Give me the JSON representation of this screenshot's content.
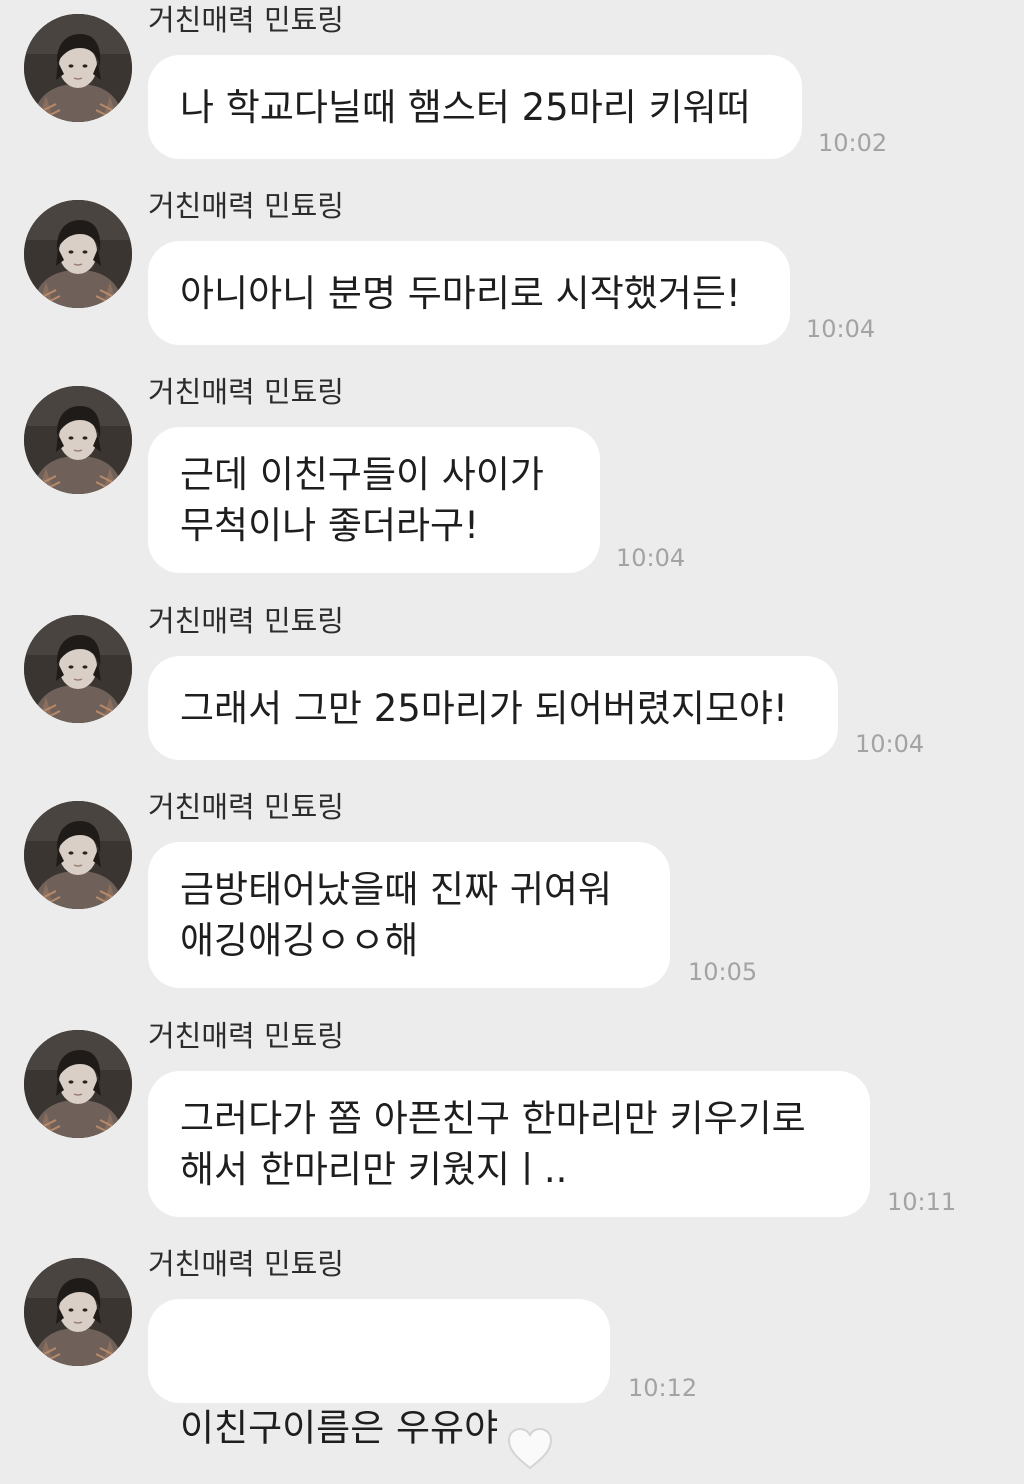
{
  "messages": [
    {
      "sender": "거친매력 민툐링",
      "text": "나 학교다닐때 햄스터 25마리 키워떠",
      "time": "10:02"
    },
    {
      "sender": "거친매력 민툐링",
      "text": "아니아니 분명 두마리로 시작했거든!",
      "time": "10:04"
    },
    {
      "sender": "거친매력 민툐링",
      "text": "근데 이친구들이 사이가\n무척이나 좋더라구!",
      "time": "10:04"
    },
    {
      "sender": "거친매력 민툐링",
      "text": "그래서 그만 25마리가 되어버렸지모야!",
      "time": "10:04"
    },
    {
      "sender": "거친매력 민툐링",
      "text": "금방태어났을때 진짜 귀여워\n애깅애깅ㅇㅇ해",
      "time": "10:05"
    },
    {
      "sender": "거친매력 민툐링",
      "text": "그러다가 쫌 아픈친구 한마리만 키우기로\n해서 한마리만 키웠지ㅣ..",
      "time": "10:11"
    },
    {
      "sender": "거친매력 민툐링",
      "text": "이친구이름은 우유야",
      "time": "10:12",
      "emoji_icon": "white-heart-icon"
    }
  ]
}
